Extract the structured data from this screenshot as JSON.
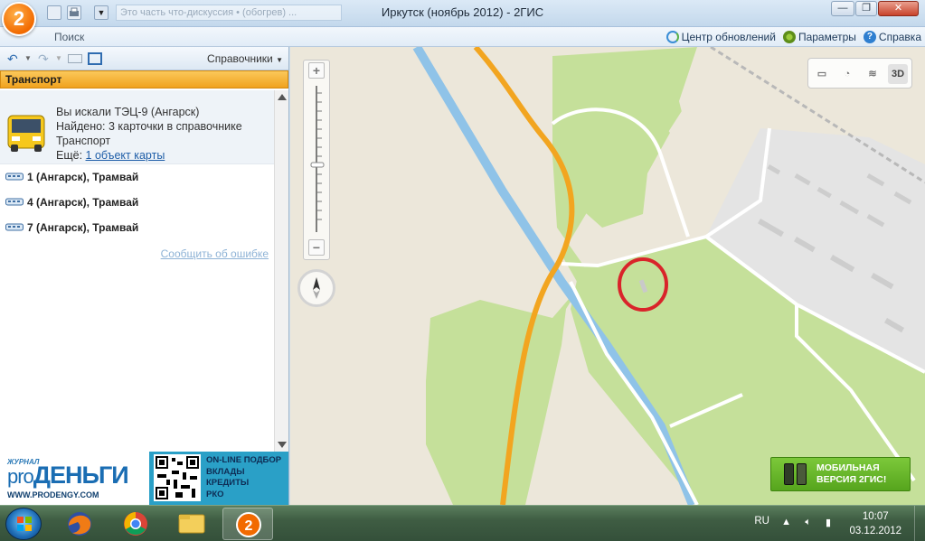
{
  "window": {
    "title": "Иркутск (ноябрь 2012) - 2ГИС",
    "logo_text": "2",
    "address_bar": "Это часть что-дискуссия • (обогрев) ..."
  },
  "ribbon": {
    "search_label": "Поиск",
    "updates_label": "Центр обновлений",
    "settings_label": "Параметры",
    "help_label": "Справка"
  },
  "left_panel": {
    "toolbar": {
      "directories_label": "Справочники"
    },
    "section_title": "Транспорт",
    "search_info": {
      "query_line": "Вы искали ТЭЦ-9 (Ангарск)",
      "found_line": "Найдено: 3 карточки в справочнике",
      "category": "Транспорт",
      "more_prefix": "Ещё:",
      "more_link": "1 объект карты"
    },
    "results": [
      {
        "number": "1",
        "label": " (Ангарск), Трамвай"
      },
      {
        "number": "4",
        "label": " (Ангарск), Трамвай"
      },
      {
        "number": "7",
        "label": " (Ангарск), Трамвай"
      }
    ],
    "report_error": "Сообщить об ошибке"
  },
  "ad": {
    "brand_small": "ЖУРНАЛ",
    "brand_pro": "pro",
    "brand_money": "ДЕНЬГИ",
    "url": "WWW.PRODENGY.COM",
    "lines": [
      "ON-LINE ПОДБОР",
      "ВКЛАДЫ",
      "КРЕДИТЫ",
      "РКО"
    ]
  },
  "map": {
    "zoom_in": "+",
    "zoom_out": "−",
    "tool_3d": "3D",
    "mobile_banner": [
      "МОБИЛЬНАЯ",
      "ВЕРСИЯ 2ГИС!"
    ]
  },
  "taskbar": {
    "language": "RU",
    "time": "10:07",
    "date": "03.12.2012"
  },
  "colors": {
    "map_background": "#ece7da",
    "forest": "#c5e09a",
    "river": "#8fc3e8",
    "main_road": "#f2a520",
    "marker": "#d9242a",
    "section_header": "#f0a21e",
    "mobile_banner": "#56a51d"
  }
}
